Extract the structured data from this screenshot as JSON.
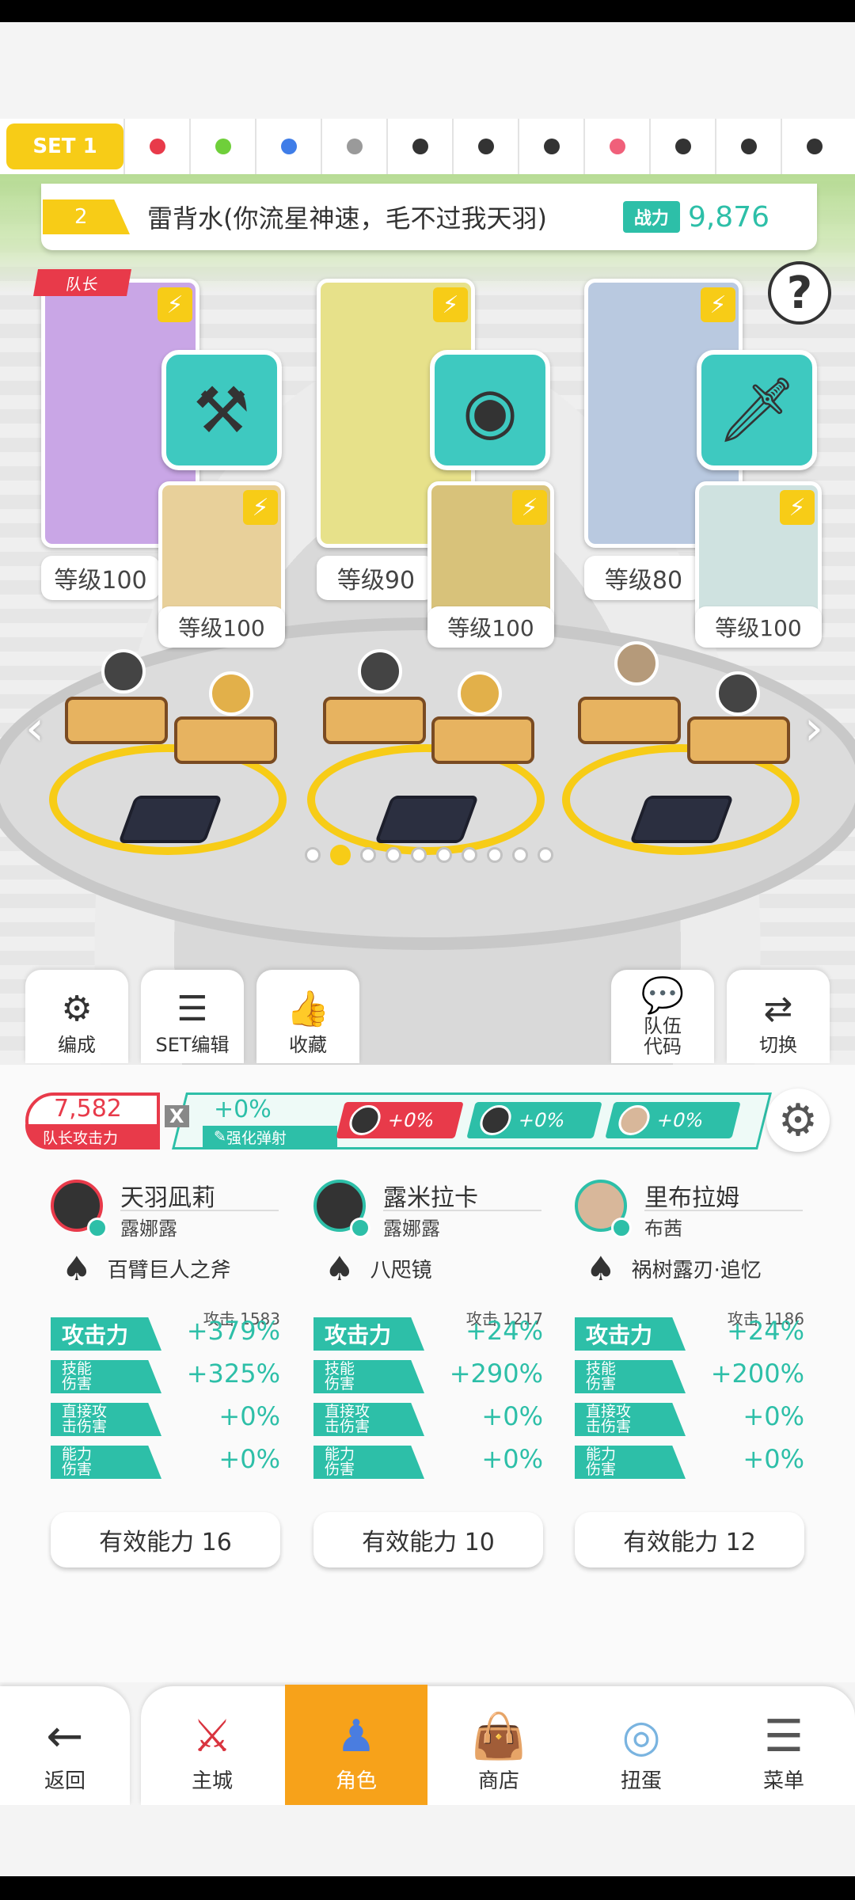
{
  "set_bar": {
    "active_label": "SET 1",
    "dots": [
      "#e83a4a",
      "#6fcf3a",
      "#3f7de8",
      "#9a9a9a",
      "#333333",
      "#333333",
      "#333333",
      "#f0607a",
      "#333333",
      "#333333",
      "#333333"
    ]
  },
  "team": {
    "number": "2",
    "name": "雷背水(你流星神速，毛不过我天羽)",
    "power_label": "战力",
    "power_value": "9,876"
  },
  "leader_label": "队长",
  "heroes": [
    {
      "level": "等级100",
      "support_level": "等级100",
      "weapon_color": "#3ec9c0",
      "portrait_color": "#c9a6e6",
      "support_color": "#e8d09a"
    },
    {
      "level": "等级90",
      "support_level": "等级100",
      "weapon_color": "#3ec9c0",
      "portrait_color": "#e7e18a",
      "support_color": "#d8c27a"
    },
    {
      "level": "等级80",
      "support_level": "等级100",
      "weapon_color": "#3ec9c0",
      "portrait_color": "#b9c9e0",
      "support_color": "#cfe2e0"
    }
  ],
  "actions": {
    "formation": "编成",
    "set_edit": "SET编辑",
    "favorite": "收藏",
    "team_code": "队伍\n代码",
    "switch": "切换"
  },
  "leader_stat": {
    "value": "7,582",
    "label": "队长攻击力"
  },
  "buff": {
    "x": "X",
    "value": "+0%",
    "label": "强化弹射",
    "chips": [
      {
        "value": "+0%",
        "color": "#e83a4a"
      },
      {
        "value": "+0%",
        "color": "#2dbfa8"
      },
      {
        "value": "+0%",
        "color": "#2dbfa8"
      }
    ]
  },
  "hero_stats": [
    {
      "name": "天羽凪莉",
      "sub": "露娜露",
      "weapon": "百臂巨人之斧",
      "base_atk": "攻击 1583",
      "rows": [
        {
          "label": "攻击力",
          "value": "+379%"
        },
        {
          "label": "技能\n伤害",
          "value": "+325%"
        },
        {
          "label": "直接攻\n击伤害",
          "value": "+0%"
        },
        {
          "label": "能力\n伤害",
          "value": "+0%"
        }
      ],
      "effect": "有效能力 16"
    },
    {
      "name": "露米拉卡",
      "sub": "露娜露",
      "weapon": "八咫镜",
      "base_atk": "攻击 1217",
      "rows": [
        {
          "label": "攻击力",
          "value": "+24%"
        },
        {
          "label": "技能\n伤害",
          "value": "+290%"
        },
        {
          "label": "直接攻\n击伤害",
          "value": "+0%"
        },
        {
          "label": "能力\n伤害",
          "value": "+0%"
        }
      ],
      "effect": "有效能力 10"
    },
    {
      "name": "里布拉姆",
      "sub": "布茜",
      "weapon": "祸树露刃·追忆",
      "base_atk": "攻击 1186",
      "rows": [
        {
          "label": "攻击力",
          "value": "+24%"
        },
        {
          "label": "技能\n伤害",
          "value": "+200%"
        },
        {
          "label": "直接攻\n击伤害",
          "value": "+0%"
        },
        {
          "label": "能力\n伤害",
          "value": "+0%"
        }
      ],
      "effect": "有效能力 12"
    }
  ],
  "nav": {
    "back": "返回",
    "items": [
      "主城",
      "角色",
      "商店",
      "扭蛋",
      "菜单"
    ],
    "active_index": 1
  }
}
